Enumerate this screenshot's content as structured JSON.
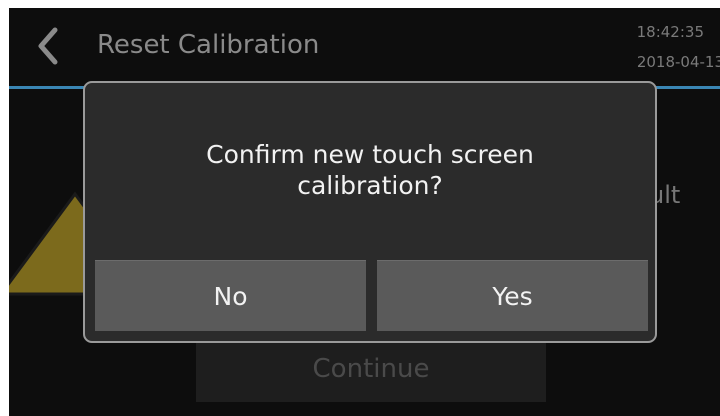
{
  "header": {
    "title": "Reset Calibration",
    "time": "18:42:35",
    "date": "2018-04-13",
    "back_icon": "chevron-left-icon"
  },
  "background": {
    "partial_text": "ult",
    "warning_icon": "warning-triangle-icon",
    "continue_label": "Continue"
  },
  "dialog": {
    "message": "Confirm new touch screen\ncalibration?",
    "no_label": "No",
    "yes_label": "Yes"
  },
  "colors": {
    "screen_bg": "#0d0d0d",
    "accent_line": "#3a86b4",
    "dialog_bg": "#2b2b2b",
    "dialog_border": "#9a9a9a",
    "button_bg": "#5a5a5a",
    "warning_fill": "#7c6a1c"
  }
}
